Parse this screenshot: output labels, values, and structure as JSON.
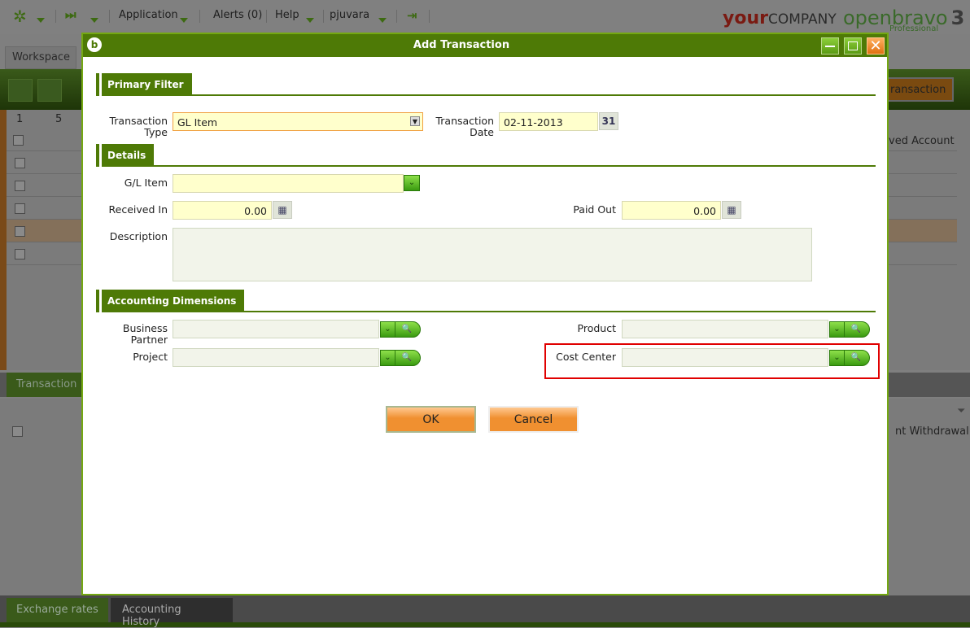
{
  "topbar": {
    "application": "Application",
    "alerts": "Alerts (0)",
    "help": "Help",
    "user": "pjuvara"
  },
  "branding": {
    "your": "your",
    "company": "COMPANY",
    "openbravo": "openbravo",
    "edition": "Professional",
    "version": "3"
  },
  "background": {
    "workspace_tab": "Workspace",
    "new_transaction": "ransaction",
    "grid_header": [
      "1",
      "5"
    ],
    "column_received_account": "ved Account",
    "transaction_tab": "Transaction",
    "column_withdrawal": "nt Withdrawal",
    "bottom_tabs": [
      "Exchange rates",
      "Accounting History"
    ]
  },
  "dialog": {
    "title": "Add Transaction",
    "primary_filter": {
      "title": "Primary Filter",
      "transaction_type_label": "Transaction Type",
      "transaction_type_value": "GL Item",
      "transaction_date_label": "Transaction Date",
      "transaction_date_value": "02-11-2013",
      "calendar_icon_text": "31"
    },
    "details": {
      "title": "Details",
      "gl_item_label": "G/L Item",
      "gl_item_value": "",
      "received_in_label": "Received In",
      "received_in_value": "0.00",
      "paid_out_label": "Paid Out",
      "paid_out_value": "0.00",
      "description_label": "Description",
      "description_value": ""
    },
    "accounting_dimensions": {
      "title": "Accounting Dimensions",
      "business_partner_label": "Business Partner",
      "project_label": "Project",
      "product_label": "Product",
      "cost_center_label": "Cost Center"
    },
    "ok_label": "OK",
    "cancel_label": "Cancel"
  },
  "colors": {
    "accent": "#4e7a06",
    "highlight": "#e00000",
    "button": "#f09030"
  }
}
